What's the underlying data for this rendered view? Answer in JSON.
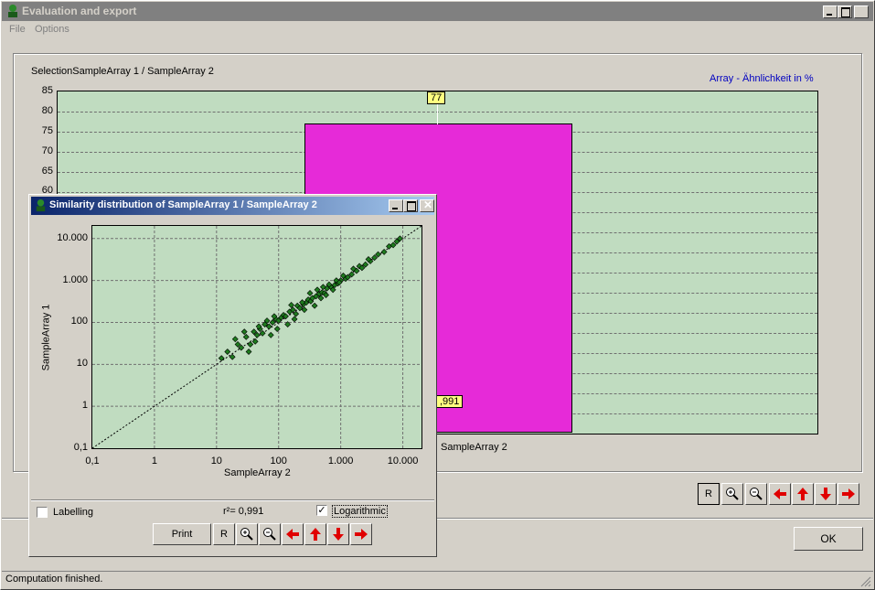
{
  "window": {
    "title": "Evaluation and export",
    "menu": [
      "File",
      "Options"
    ],
    "status": "Computation finished.",
    "ok_label": "OK"
  },
  "bar_chart": {
    "title": "SelectionSampleArray 1 / SampleArray 2",
    "legend": "Array - Ähnlichkeit in %",
    "bar_label": "77",
    "bar_value": 77,
    "small_label": ",991",
    "x_label_visible": "SampleArray 2",
    "y_ticks": [
      "85",
      "80",
      "75",
      "70",
      "65",
      "60"
    ],
    "buttons": [
      "R"
    ]
  },
  "child_window": {
    "title": "Similarity distribution of SampleArray 1 / SampleArray 2",
    "labelling_label": "Labelling",
    "labelling_checked": false,
    "r2_text": "r²= 0,991",
    "log_label": "Logarithmic",
    "log_checked": true,
    "print_label": "Print",
    "r_label": "R"
  },
  "chart_data": {
    "type": "scatter",
    "title": "",
    "xlabel": "SampleArray 2",
    "ylabel": "SampleArray 1",
    "log_scale": true,
    "xlim": [
      0.1,
      20000
    ],
    "ylim": [
      0.1,
      20000
    ],
    "x_ticks": [
      "0,1",
      "1",
      "10",
      "100",
      "1.000",
      "10.000"
    ],
    "y_ticks": [
      "10.000",
      "1.000",
      "100",
      "10",
      "1",
      "0,1"
    ],
    "reference_line": "y = x",
    "marker_color": "#1e7b1e",
    "r_squared": 0.991,
    "points_x": [
      12,
      15,
      18,
      22,
      25,
      30,
      35,
      40,
      45,
      50,
      55,
      60,
      70,
      80,
      90,
      100,
      110,
      120,
      130,
      150,
      170,
      190,
      200,
      220,
      250,
      280,
      300,
      330,
      350,
      400,
      450,
      500,
      550,
      600,
      700,
      800,
      900,
      1000,
      1200,
      1500,
      1800,
      2000,
      2500,
      3000,
      3500,
      4000,
      5000,
      6000,
      7000,
      8000,
      9000,
      20,
      28,
      33,
      42,
      48,
      65,
      75,
      85,
      95,
      140,
      160,
      180,
      240,
      260,
      320,
      380,
      420,
      480,
      520,
      580,
      650,
      750,
      850,
      950,
      1100,
      1300,
      1600,
      2200,
      2800
    ],
    "points_y": [
      14,
      20,
      15,
      30,
      25,
      45,
      30,
      60,
      50,
      70,
      55,
      90,
      80,
      100,
      120,
      110,
      130,
      150,
      140,
      180,
      200,
      160,
      250,
      220,
      270,
      300,
      350,
      320,
      380,
      420,
      480,
      520,
      500,
      650,
      700,
      780,
      850,
      1000,
      1100,
      1400,
      1700,
      2200,
      2400,
      2900,
      3500,
      4200,
      4800,
      6500,
      7000,
      8500,
      10000,
      40,
      60,
      20,
      35,
      80,
      110,
      50,
      140,
      70,
      90,
      260,
      120,
      300,
      200,
      500,
      250,
      600,
      380,
      700,
      450,
      800,
      600,
      1000,
      900,
      1300,
      1200,
      1900,
      2000,
      3200
    ]
  }
}
